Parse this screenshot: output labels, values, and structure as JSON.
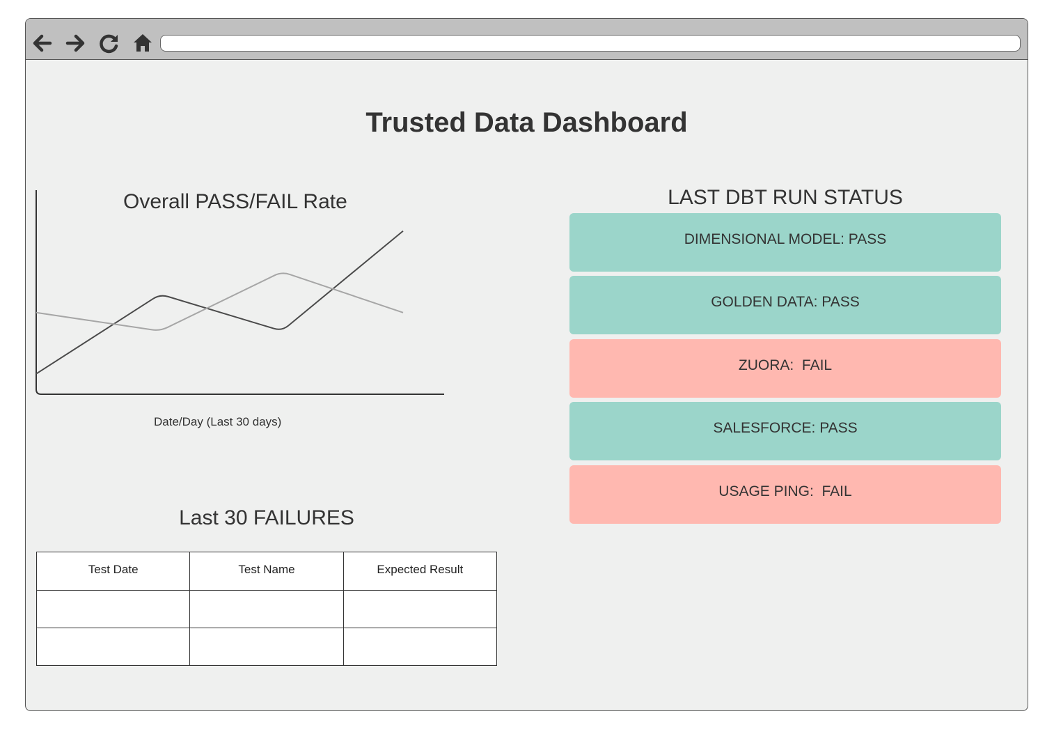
{
  "browser": {
    "nav": [
      {
        "name": "back-arrow-icon"
      },
      {
        "name": "forward-arrow-icon"
      },
      {
        "name": "reload-icon"
      },
      {
        "name": "home-icon"
      }
    ],
    "address": ""
  },
  "page": {
    "title": "Trusted Data Dashboard"
  },
  "chart_data": {
    "type": "line",
    "title": "Overall PASS/FAIL Rate",
    "xlabel": "Date/Day (Last 30 days)",
    "ylabel": "",
    "x": [
      0,
      1,
      2,
      3
    ],
    "series": [
      {
        "values": [
          0.1,
          0.49,
          0.31,
          0.8
        ],
        "color": "#4a4a4a"
      },
      {
        "values": [
          0.4,
          0.31,
          0.6,
          0.4
        ],
        "color": "#a6a6a6"
      }
    ],
    "ylim": [
      0,
      1
    ],
    "grid": false
  },
  "status": {
    "heading": "LAST DBT RUN STATUS",
    "colors": {
      "pass": "#9bd5ca",
      "fail": "#ffb8b0"
    },
    "items": [
      {
        "label": "DIMENSIONAL MODEL: PASS",
        "state": "pass"
      },
      {
        "label": "GOLDEN DATA: PASS",
        "state": "pass"
      },
      {
        "label": "ZUORA:  FAIL",
        "state": "fail"
      },
      {
        "label": "SALESFORCE: PASS",
        "state": "pass"
      },
      {
        "label": "USAGE PING:  FAIL",
        "state": "fail"
      }
    ]
  },
  "failures": {
    "heading": "Last 30 FAILURES",
    "columns": [
      "Test Date",
      "Test Name",
      "Expected Result"
    ],
    "rows": [
      [
        "",
        "",
        ""
      ],
      [
        "",
        "",
        ""
      ]
    ]
  }
}
